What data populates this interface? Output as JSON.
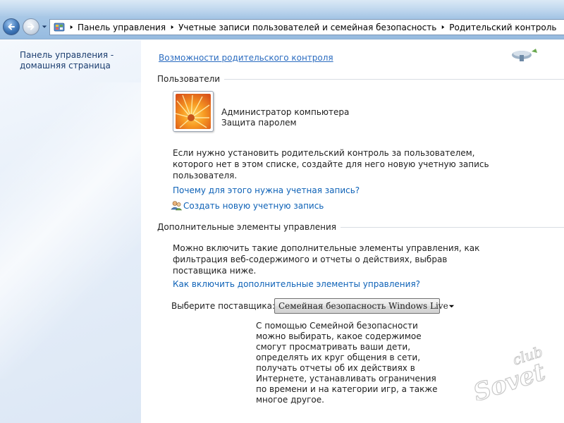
{
  "address_bar": {
    "breadcrumbs": [
      "Панель управления",
      "Учетные записи пользователей и семейная безопасность",
      "Родительский контроль"
    ]
  },
  "left_pane": {
    "home_link_line1": "Панель управления -",
    "home_link_line2": "домашняя страница"
  },
  "main": {
    "top_link": "Возможности родительского контроля",
    "users_section": {
      "title": "Пользователи",
      "user_name": "Администратор компьютера",
      "user_status": "Защита паролем",
      "info_lines": [
        "Если нужно установить родительский контроль за пользователем,",
        "которого нет в этом списке, создайте для него новую учетную запись",
        "пользователя."
      ],
      "why_link": "Почему для этого нужна учетная запись?",
      "create_link": "Создать новую учетную запись"
    },
    "extra_section": {
      "title": "Дополнительные элементы управления",
      "info_lines": [
        "Можно включить такие дополнительные элементы управления, как",
        "фильтрация веб-содержимого и отчеты о действиях, выбрав",
        "поставщика ниже."
      ],
      "how_link": "Как включить дополнительные элементы управления?",
      "provider_label": "Выберите поставщика:",
      "provider_selected": "Семейная безопасность Windows Live",
      "provider_desc_lines": [
        "С помощью Семейной безопасности",
        "можно выбирать, какое содержимое",
        "смогут просматривать ваши дети,",
        "определять их круг общения в сети,",
        "получать отчеты об их действиях в",
        "Интернете, устанавливать ограничения",
        "по времени и на категории игр, а также",
        "многое другое."
      ]
    }
  },
  "watermark": {
    "line1": "club",
    "line2": "Sovet"
  },
  "colors": {
    "link": "#0e62b7",
    "left_pane_bg": "#e7eff9",
    "title_bar": "#a7c7e6"
  },
  "icons": {
    "back": "arrow-left-icon",
    "forward": "arrow-right-icon",
    "control_panel": "control-panel-icon",
    "create_user": "users-icon",
    "dropdown": "chevron-down-icon"
  }
}
